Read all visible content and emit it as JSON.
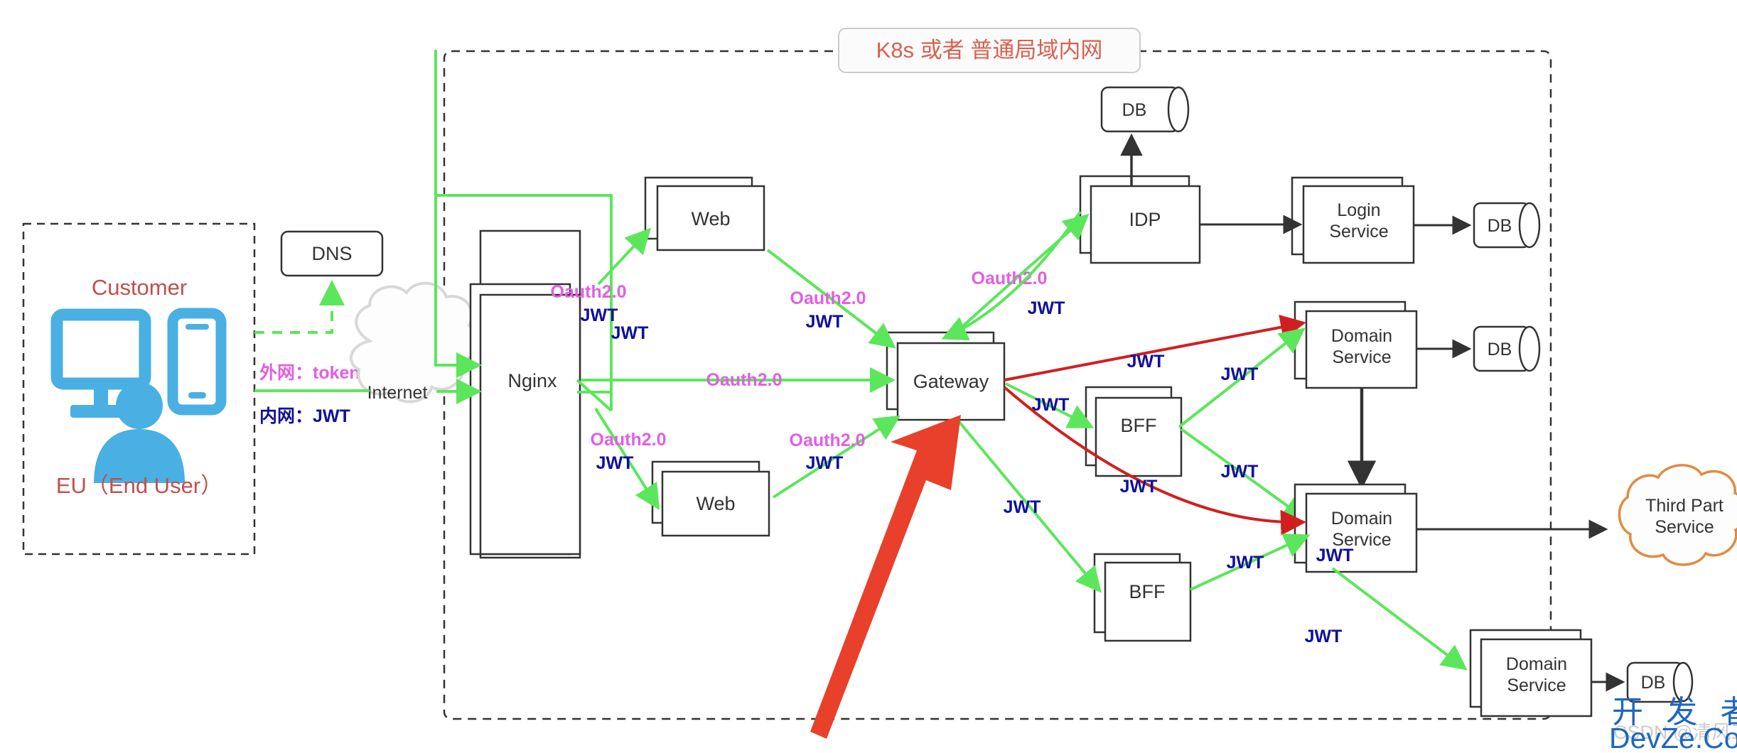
{
  "diagram": {
    "title": "K8s 或者 普通局域内网",
    "title_color": "#d9604f"
  },
  "customer_zone": {
    "heading": "Customer",
    "user_label": "EU（End User）",
    "icons": [
      "monitor-icon",
      "phone-icon",
      "user-icon"
    ],
    "icon_color": "#4aafe3",
    "heading_color": "#c0504d"
  },
  "network_labels": {
    "external": "外网：token",
    "external_color": "#e25fe2",
    "internal": "内网：JWT",
    "internal_color": "#10109b"
  },
  "nodes": {
    "dns": "DNS",
    "internet": "Internet",
    "nginx": "Nginx",
    "web_top": "Web",
    "web_bottom": "Web",
    "gateway": "Gateway",
    "idp": "IDP",
    "db_idp": "DB",
    "login_service": "Login\nService",
    "login_service_l1": "Login",
    "login_service_l2": "Service",
    "db_login": "DB",
    "domain_service_1_l1": "Domain",
    "domain_service_1_l2": "Service",
    "db_domain1": "DB",
    "domain_service_2_l1": "Domain",
    "domain_service_2_l2": "Service",
    "domain_service_3_l1": "Domain",
    "domain_service_3_l2": "Service",
    "db_domain3": "DB",
    "bff_top": "BFF",
    "bff_bottom": "BFF",
    "third_party_l1": "Third Part",
    "third_party_l2": "Service"
  },
  "edge_labels": {
    "oauth": "Oauth2.0",
    "jwt": "JWT",
    "nginx_web_top_oauth": "Oauth2.0",
    "nginx_web_top_jwt": "JWT",
    "nginx_gateway_jwt": "JWT",
    "nginx_gateway_oauth": "Oauth2.0",
    "nginx_web_bottom_oauth": "Oauth2.0",
    "nginx_web_bottom_jwt": "JWT",
    "web_top_gateway_oauth": "Oauth2.0",
    "web_top_gateway_jwt": "JWT",
    "web_bottom_gateway_oauth": "Oauth2.0",
    "web_bottom_gateway_jwt": "JWT",
    "gateway_idp_oauth": "Oauth2.0",
    "idp_gateway_jwt": "JWT",
    "gateway_domain1_jwt": "JWT",
    "gateway_bff_top_jwt": "JWT",
    "gateway_domain2_jwt": "JWT",
    "bff_top_domain1_jwt": "JWT",
    "bff_top_domain2_jwt": "JWT",
    "gateway_bff_bottom_jwt": "JWT",
    "bff_bottom_domain2_jwt": "JWT",
    "domain2_corner_jwt": "JWT",
    "bff_bottom_domain3_jwt": "JWT"
  },
  "colors": {
    "green": "#5ce65c",
    "red": "#d11f1f",
    "big_arrow_red": "#e8402a",
    "box_stroke": "#333333",
    "cloud_orange": "#e08b42",
    "dashed": "#333333",
    "magenta": "#e25fe2",
    "navy": "#10109b"
  },
  "annotation": {
    "big_arrow": "red-highlight-arrow-pointing-to-gateway"
  },
  "watermark": {
    "cn": "开 发 者",
    "en": "DevZe.CoM",
    "faint": "CSDN @清风工作室"
  }
}
